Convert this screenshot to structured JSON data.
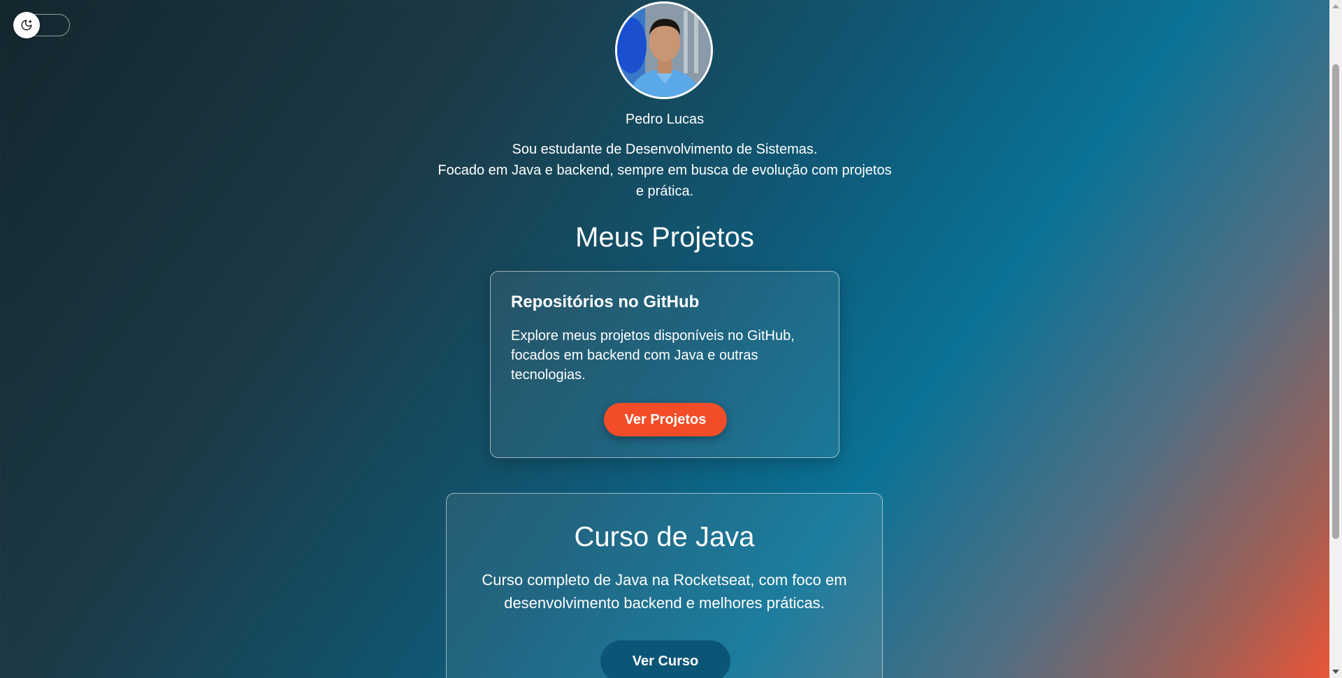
{
  "theme_toggle": {
    "icon": "moon-star-icon"
  },
  "profile": {
    "avatar_icon": "profile-photo",
    "name": "Pedro Lucas",
    "bio_line1": "Sou estudante de Desenvolvimento de Sistemas.",
    "bio_line2": "Focado em Java e backend, sempre em busca de evolução com projetos e prática."
  },
  "projects": {
    "title": "Meus Projetos",
    "github_card": {
      "title": "Repositórios no GitHub",
      "description": "Explore meus projetos disponíveis no GitHub, focados em backend com Java e outras tecnologias.",
      "button_label": "Ver Projetos"
    },
    "course_card": {
      "title": "Curso de Java",
      "description": "Curso completo de Java na Rocketseat, com foco em desenvolvimento backend e melhores práticas.",
      "button_label": "Ver Curso"
    }
  },
  "colors": {
    "accent_orange": "#f24d28",
    "accent_blue": "#0b5677"
  }
}
